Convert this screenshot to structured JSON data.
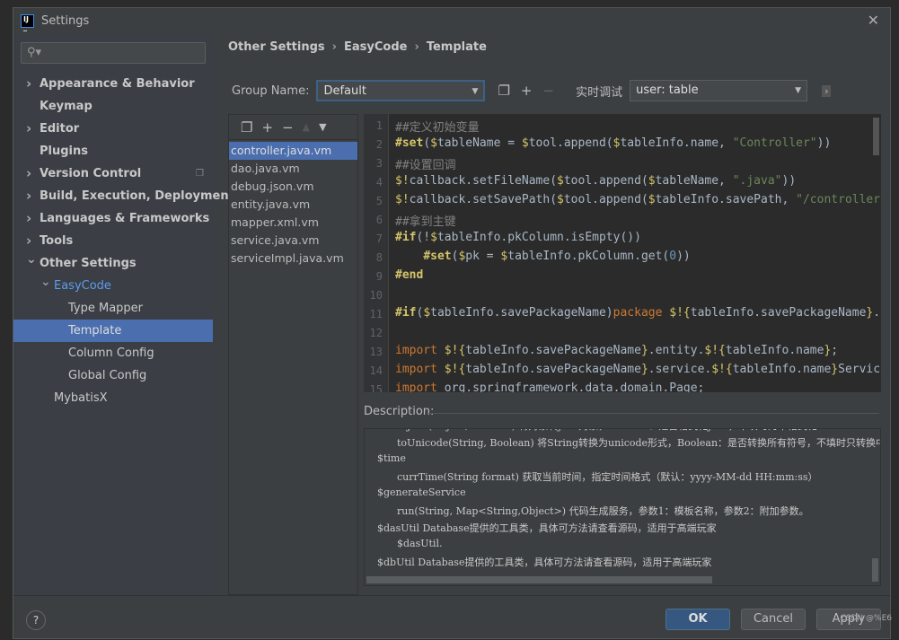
{
  "window": {
    "title": "Settings",
    "logo": "IJ"
  },
  "sidebar": {
    "search_placeholder": "",
    "items": [
      {
        "label": "Appearance & Behavior",
        "bold": true,
        "arrow": ">",
        "indent": 0
      },
      {
        "label": "Keymap",
        "bold": true,
        "indent": 0
      },
      {
        "label": "Editor",
        "bold": true,
        "arrow": ">",
        "indent": 0
      },
      {
        "label": "Plugins",
        "bold": true,
        "indent": 0
      },
      {
        "label": "Version Control",
        "bold": true,
        "arrow": ">",
        "indent": 0,
        "icon": "copy-icon"
      },
      {
        "label": "Build, Execution, Deployment",
        "bold": true,
        "arrow": ">",
        "indent": 0
      },
      {
        "label": "Languages & Frameworks",
        "bold": true,
        "arrow": ">",
        "indent": 0
      },
      {
        "label": "Tools",
        "bold": true,
        "arrow": ">",
        "indent": 0
      },
      {
        "label": "Other Settings",
        "bold": true,
        "arrow": "v",
        "indent": 0
      },
      {
        "label": "EasyCode",
        "arrow": "v",
        "indent": 1
      },
      {
        "label": "Type Mapper",
        "indent": 2
      },
      {
        "label": "Template",
        "indent": 2,
        "selected": true
      },
      {
        "label": "Column Config",
        "indent": 2
      },
      {
        "label": "Global Config",
        "indent": 2
      },
      {
        "label": "MybatisX",
        "indent": 1
      }
    ]
  },
  "breadcrumb": [
    "Other Settings",
    "EasyCode",
    "Template"
  ],
  "toolbar": {
    "group_label": "Group Name:",
    "group_value": "Default",
    "debug_label": "实时调试",
    "debug_value": "user: table"
  },
  "templates": {
    "selected": 0,
    "items": [
      "controller.java.vm",
      "dao.java.vm",
      "debug.json.vm",
      "entity.java.vm",
      "mapper.xml.vm",
      "service.java.vm",
      "serviceImpl.java.vm"
    ]
  },
  "editor": {
    "lines": [
      "##定义初始变量",
      "#set($tableName = $tool.append($tableInfo.name, \"Controller\"))",
      "##设置回调",
      "$!callback.setFileName($tool.append($tableName, \".java\"))",
      "$!callback.setSavePath($tool.append($tableInfo.savePath, \"/controller\"))",
      "##拿到主键",
      "#if(!$tableInfo.pkColumn.isEmpty())",
      "    #set($pk = $tableInfo.pkColumn.get(0))",
      "#end",
      "",
      "#if($tableInfo.savePackageName)package $!{tableInfo.savePackageName}.controller;#end",
      "",
      "import $!{tableInfo.savePackageName}.entity.$!{tableInfo.name};",
      "import $!{tableInfo.savePackageName}.service.$!{tableInfo.name}Service;",
      "import org.springframework.data.domain.Page;"
    ]
  },
  "description": {
    "label": "Description:",
    "lines": [
      {
        "text": "toJson(Object, Boolean) 将对象转json对象，Boolean：是否格式化json，不填时为不格式化",
        "indent": 1
      },
      {
        "text": "toUnicode(String, Boolean) 将String转换为unicode形式，Boolean：是否转换所有符号，不填时只转换中文及中文符号",
        "indent": 1
      },
      {
        "text": "$time",
        "indent": 0
      },
      {
        "text": "currTime(String format) 获取当前时间，指定时间格式（默认：yyyy-MM-dd HH:mm:ss）",
        "indent": 1
      },
      {
        "text": "$generateService",
        "indent": 0
      },
      {
        "text": "run(String, Map<String,Object>) 代码生成服务，参数1：模板名称，参数2：附加参数。",
        "indent": 1
      },
      {
        "text": "$dasUtil Database提供的工具类，具体可方法请查看源码，适用于高端玩家",
        "indent": 0
      },
      {
        "text": "$dasUtil.",
        "indent": 1
      },
      {
        "text": "$dbUtil  Database提供的工具类，具体可方法请查看源码，适用于高端玩家",
        "indent": 0
      }
    ]
  },
  "footer": {
    "help": "?",
    "ok": "OK",
    "cancel": "Cancel",
    "apply": "Apply"
  },
  "watermark": "CSDN @%E6",
  "colors": {
    "accent": "#4b6eaf",
    "ok_button": "#365880",
    "keyword": "#cc7832",
    "string": "#6a8759",
    "comment": "#808080"
  }
}
